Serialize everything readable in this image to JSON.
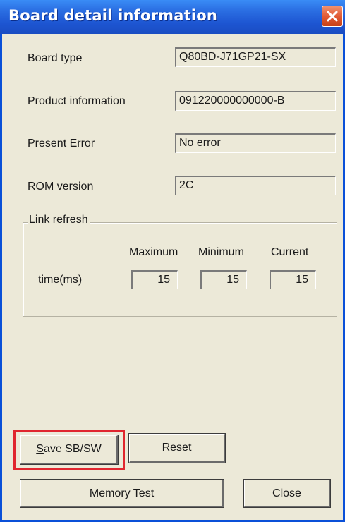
{
  "window": {
    "title": "Board detail information"
  },
  "fields": {
    "board_type": {
      "label": "Board type",
      "value": "Q80BD-J71GP21-SX"
    },
    "product_info": {
      "label": "Product information",
      "value": "091220000000000-B"
    },
    "present_error": {
      "label": "Present Error",
      "value": "No error"
    },
    "rom_version": {
      "label": "ROM version",
      "value": "2C"
    }
  },
  "link_refresh": {
    "title": "Link refresh",
    "row_label": "time(ms)",
    "columns": [
      {
        "header": "Maximum",
        "value": "15"
      },
      {
        "header": "Minimum",
        "value": "15"
      },
      {
        "header": "Current",
        "value": "15"
      }
    ]
  },
  "buttons": {
    "save_first": "S",
    "save_rest": "ave SB/SW",
    "reset": "Reset",
    "memory_test": "Memory Test",
    "close": "Close"
  },
  "colors": {
    "title_bar": "#1D55D1",
    "highlight": "#E0262F",
    "dialog_bg": "#ECE9D8"
  },
  "icons": {
    "close": "close-x-icon"
  }
}
